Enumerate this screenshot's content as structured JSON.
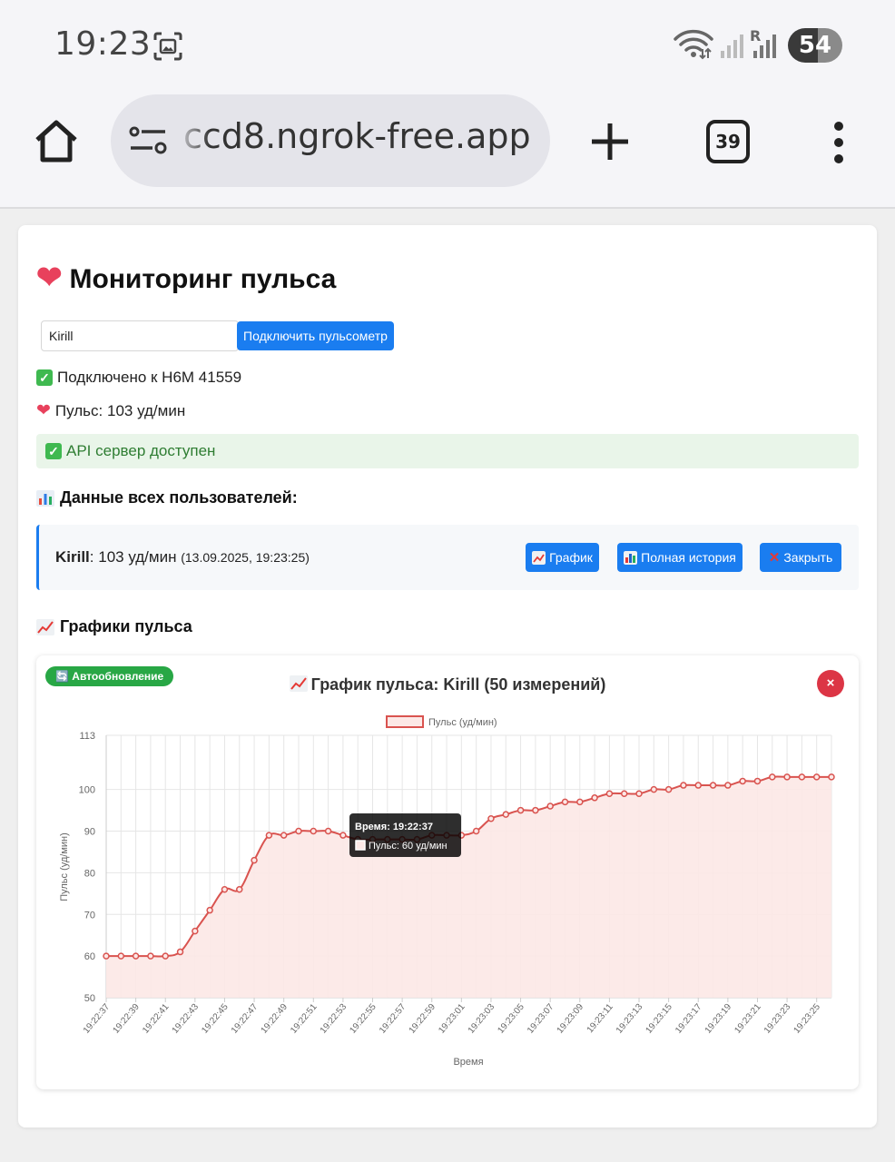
{
  "status_bar": {
    "time": "19:23",
    "roaming_letter": "R",
    "battery": "54"
  },
  "browser": {
    "url": "ccd8.ngrok-free.app",
    "tab_count": "39"
  },
  "page": {
    "title": "Мониторинг пульса",
    "input_value": "Kirill",
    "connect_button": "Подключить пульсометр",
    "status_connected": "Подключено к H6M 41559",
    "status_pulse": "Пульс: 103 уд/мин",
    "api_status": "API сервер доступен",
    "users_section_title": "Данные всех пользователей:",
    "user_row": {
      "name": "Kirill",
      "value": ": 103 уд/мин",
      "timestamp": "(13.09.2025, 19:23:25)",
      "chart_button": "График",
      "history_button": "Полная история",
      "close_button": "Закрыть"
    },
    "charts_section_title": "Графики пульса"
  },
  "chart_panel": {
    "auto_update": "Автообновление",
    "title": "График пульса: Kirill (50 измерений)",
    "close_symbol": "×",
    "tooltip_title": "Время: 19:22:37",
    "tooltip_body": "Пульс: 60 уд/мин"
  },
  "colors": {
    "accent_blue": "#1a7df0",
    "line_red": "#d9534f",
    "fill_red": "#fce8e6",
    "success_green": "#28a745",
    "danger_red": "#dc3545"
  },
  "chart_data": {
    "type": "line",
    "title": "",
    "xlabel": "Время",
    "ylabel": "Пульс (уд/мин)",
    "ylim": [
      50,
      113
    ],
    "yticks": [
      50,
      60,
      70,
      80,
      90,
      100,
      113
    ],
    "grid": true,
    "legend_position": "top",
    "x_tick_labels": [
      "19:22:37",
      "19:22:39",
      "19:22:41",
      "19:22:43",
      "19:22:45",
      "19:22:47",
      "19:22:49",
      "19:22:51",
      "19:22:53",
      "19:22:55",
      "19:22:57",
      "19:22:59",
      "19:23:01",
      "19:23:03",
      "19:23:05",
      "19:23:07",
      "19:23:09",
      "19:23:11",
      "19:23:13",
      "19:23:15",
      "19:23:17",
      "19:23:19",
      "19:23:21",
      "19:23:23",
      "19:23:25"
    ],
    "series": [
      {
        "name": "Пульс (уд/мин)",
        "values": [
          60,
          60,
          60,
          60,
          60,
          61,
          66,
          71,
          76,
          76,
          83,
          89,
          89,
          90,
          90,
          90,
          89,
          88,
          88,
          88,
          88,
          88,
          89,
          89,
          89,
          90,
          93,
          94,
          95,
          95,
          96,
          97,
          97,
          98,
          99,
          99,
          99,
          100,
          100,
          101,
          101,
          101,
          101,
          102,
          102,
          103,
          103,
          103,
          103,
          103
        ]
      }
    ]
  }
}
